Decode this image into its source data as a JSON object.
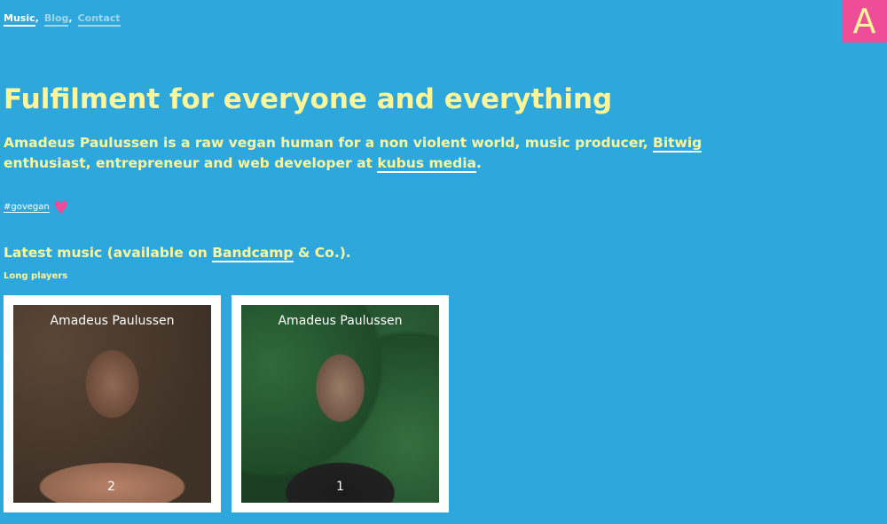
{
  "nav": {
    "items": [
      {
        "label": "Music",
        "active": true
      },
      {
        "label": "Blog",
        "active": false
      },
      {
        "label": "Contact",
        "active": false
      }
    ],
    "separator": ","
  },
  "logo": {
    "letter": "A"
  },
  "headline": "Fulfilment for everyone and everything",
  "intro": {
    "part1": "Amadeus Paulussen is a raw vegan human for a non violent world, music producer, ",
    "link1": "Bitwig",
    "part2": " enthusiast, entrepreneur and web developer at ",
    "link2": "kubus media",
    "part3": "."
  },
  "tag": {
    "label": "#govegan",
    "heart_icon": "heart-icon"
  },
  "music_section": {
    "title_part1": "Latest music (available on ",
    "title_link": "Bandcamp",
    "title_part2": " & Co.).",
    "subtitle": "Long players"
  },
  "albums": [
    {
      "artist": "Amadeus Paulussen",
      "number": "2"
    },
    {
      "artist": "Amadeus Paulussen",
      "number": "1"
    }
  ],
  "colors": {
    "background": "#2ea8dc",
    "text": "#fff59a",
    "accent_pink": "#ee4d98",
    "white": "#ffffff"
  }
}
